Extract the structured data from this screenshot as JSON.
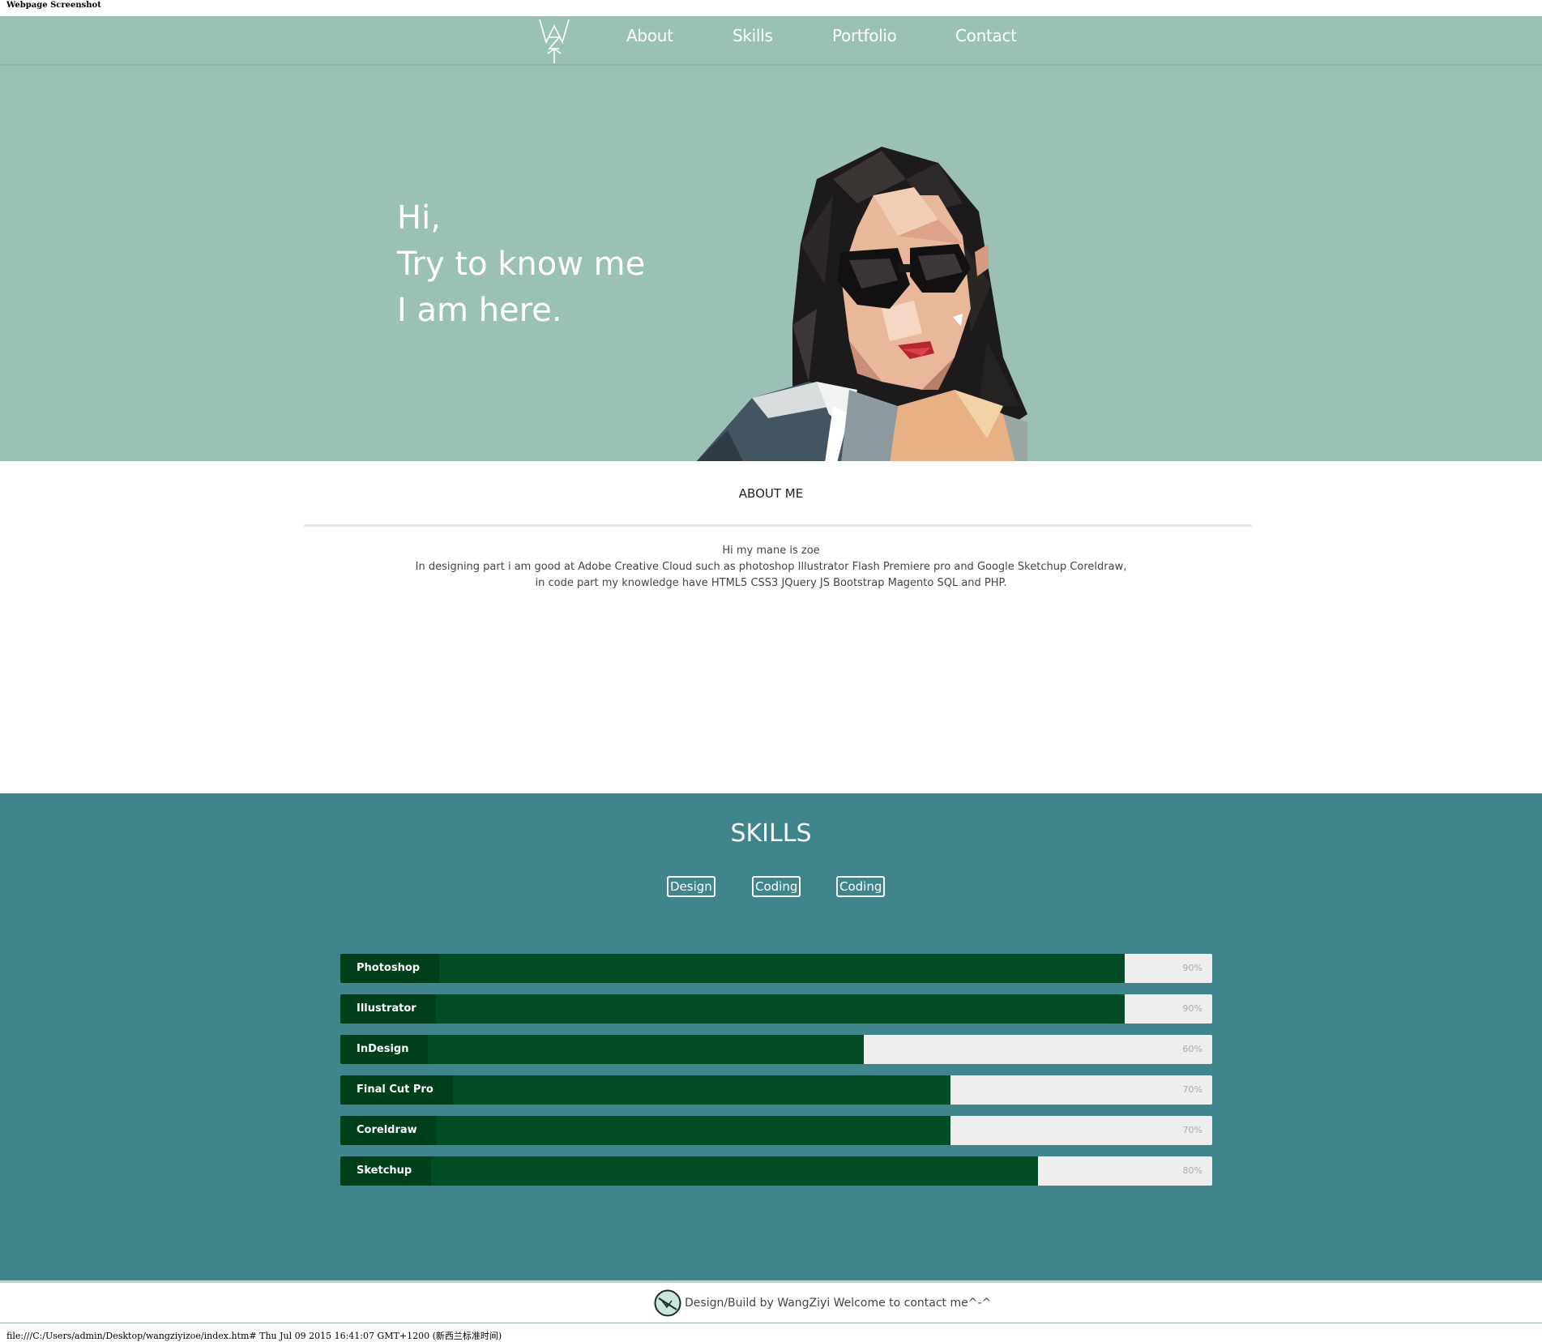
{
  "window": {
    "title": "Webpage Screenshot"
  },
  "nav": {
    "logo_icon": "wz-monogram-icon",
    "items": [
      {
        "label": "About"
      },
      {
        "label": "Skills"
      },
      {
        "label": "Portfolio"
      },
      {
        "label": "Contact"
      }
    ]
  },
  "hero": {
    "line1": "Hi,",
    "line2": "Try to know me",
    "line3": "I am here.",
    "image": "low-poly-portrait"
  },
  "about": {
    "title": "ABOUT ME",
    "line1": "Hi my mane is zoe",
    "line2": "In designing part i am good at Adobe Creative Cloud such as photoshop Illustrator Flash Premiere pro and Google Sketchup Coreldraw,",
    "line3": "in code part my knowledge have HTML5 CSS3 JQuery JS Bootstrap Magento SQL and PHP."
  },
  "skills": {
    "title": "SKILLS",
    "tabs": [
      {
        "label": "Design"
      },
      {
        "label": "Coding"
      },
      {
        "label": "Coding"
      }
    ],
    "bars": [
      {
        "label": "Photoshop",
        "percent": 90,
        "percent_text": "90%"
      },
      {
        "label": "Illustrator",
        "percent": 90,
        "percent_text": "90%"
      },
      {
        "label": "InDesign",
        "percent": 60,
        "percent_text": "60%"
      },
      {
        "label": "Final Cut Pro",
        "percent": 70,
        "percent_text": "70%"
      },
      {
        "label": "Coreldraw",
        "percent": 70,
        "percent_text": "70%"
      },
      {
        "label": "Sketchup",
        "percent": 80,
        "percent_text": "80%"
      }
    ]
  },
  "footer": {
    "text": "Design/Build by WangZiyi Welcome to contact me^-^",
    "logo_icon": "wz-circle-logo-icon"
  },
  "statusbar": {
    "text": "file:///C:/Users/admin/Desktop/wangziyizoe/index.htm# Thu Jul 09 2015 16:41:07 GMT+1200 (新西兰标准时间)"
  },
  "colors": {
    "header_bg": "#9bc1b7",
    "skills_bg": "#40858c",
    "bar_fill": "#024d26",
    "bar_track": "#eeeeee"
  }
}
